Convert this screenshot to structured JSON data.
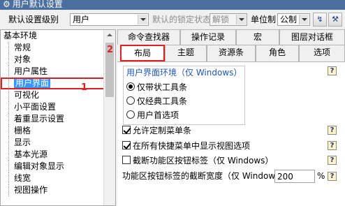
{
  "window": {
    "title": "用户默认设置"
  },
  "topbar": {
    "level_label": "默认设置级别",
    "level_value": "用户",
    "lock_label": "默认的锁定状态",
    "lock_value": "解锁",
    "unit_label": "单位制",
    "unit_value": "公制"
  },
  "tree": {
    "root": "基本环境",
    "items": [
      {
        "label": "常规"
      },
      {
        "label": "对象"
      },
      {
        "label": "用户属性"
      },
      {
        "label": "用户界面"
      },
      {
        "label": "可视化"
      },
      {
        "label": "小平面设置"
      },
      {
        "label": "着重显示设置"
      },
      {
        "label": "栅格"
      },
      {
        "label": "显示"
      },
      {
        "label": "基本光源"
      },
      {
        "label": "编辑对象显示"
      },
      {
        "label": "线宽"
      },
      {
        "label": "视图操作"
      }
    ]
  },
  "callouts": {
    "one": "1",
    "two": "2"
  },
  "tabs_row1": [
    {
      "label": "命令查找器"
    },
    {
      "label": "操作记录"
    },
    {
      "label": "宏"
    },
    {
      "label": "图层对话框"
    }
  ],
  "tabs_row2": [
    {
      "label": "布局"
    },
    {
      "label": "主题"
    },
    {
      "label": "资源条"
    },
    {
      "label": "角色"
    },
    {
      "label": "选项"
    }
  ],
  "pane": {
    "group_title": "用户界面环境（仅 Windows）",
    "radios": [
      {
        "label": "仅带状工具条",
        "checked": true
      },
      {
        "label": "仅经典工具条",
        "checked": false
      },
      {
        "label": "用户首选项",
        "checked": false
      }
    ],
    "checkboxes": [
      {
        "label": "允许定制菜单条",
        "checked": true
      },
      {
        "label": "在所有快捷菜单中显示视图选项",
        "checked": true
      },
      {
        "label": "截断功能区按钮标签（仅 Windows）",
        "checked": false
      }
    ],
    "truncate_label": "功能区按钮标签的截断宽度（仅 Window",
    "truncate_value": "200",
    "truncate_unit": "%",
    "help_glyph": "?"
  },
  "colors": {
    "titlebar": "#4a6f9e",
    "selection": "#3399ff",
    "callout": "#e02020",
    "group_title": "#1f57b8"
  }
}
